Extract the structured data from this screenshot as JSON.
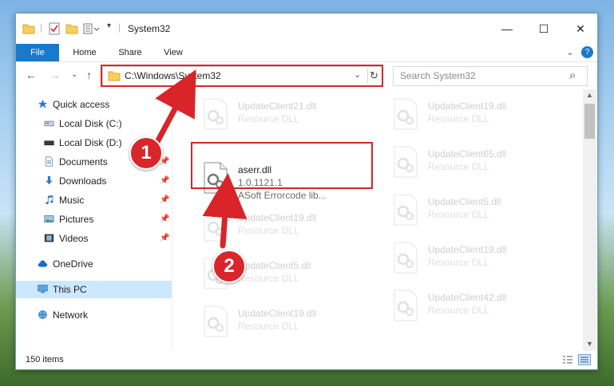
{
  "window": {
    "title": "System32",
    "minimize": "—",
    "maximize": "☐",
    "close": "✕"
  },
  "ribbon": {
    "tabs": [
      "File",
      "Home",
      "Share",
      "View"
    ],
    "expand": "⌄",
    "help": "?"
  },
  "nav": {
    "back": "←",
    "forward": "→",
    "recent": "⌄",
    "up": "↑",
    "address": "C:\\Windows\\System32",
    "address_dropdown": "⌄",
    "refresh": "↻",
    "search_placeholder": "Search System32",
    "search_icon": "⌕"
  },
  "sidebar": {
    "items": [
      {
        "label": "Quick access"
      },
      {
        "label": "Local Disk (C:)"
      },
      {
        "label": "Local Disk (D:)"
      },
      {
        "label": "Documents"
      },
      {
        "label": "Downloads"
      },
      {
        "label": "Music"
      },
      {
        "label": "Pictures"
      },
      {
        "label": "Videos"
      },
      {
        "label": "OneDrive"
      },
      {
        "label": "This PC"
      },
      {
        "label": "Network"
      }
    ],
    "pin": "📌"
  },
  "files": {
    "left": [
      {
        "name": "UpdateClient21.dll",
        "type": "Resource DLL"
      },
      {
        "name": "aserr.dll",
        "version": "1.0.1121.1",
        "description": "ASoft Errorcode lib..."
      },
      {
        "name": "UpdateClient19.dll",
        "type": "Resource DLL"
      },
      {
        "name": "UpdateClient5.dll",
        "type": "Resource DLL"
      },
      {
        "name": "UpdateClient19.dll",
        "type": "Resource DLL"
      }
    ],
    "right": [
      {
        "name": "UpdateClient19.dll",
        "type": "Resource DLL"
      },
      {
        "name": "UpdateClient65.dll",
        "type": "Resource DLL"
      },
      {
        "name": "UpdateClient5.dll",
        "type": "Resource DLL"
      },
      {
        "name": "UpdateClient19.dll",
        "type": "Resource DLL"
      },
      {
        "name": "UpdateClient42.dll",
        "type": "Resource DLL"
      }
    ]
  },
  "status": {
    "count": "150 items"
  },
  "annotations": {
    "step1": "1",
    "step2": "2",
    "color": "#d9242a"
  }
}
